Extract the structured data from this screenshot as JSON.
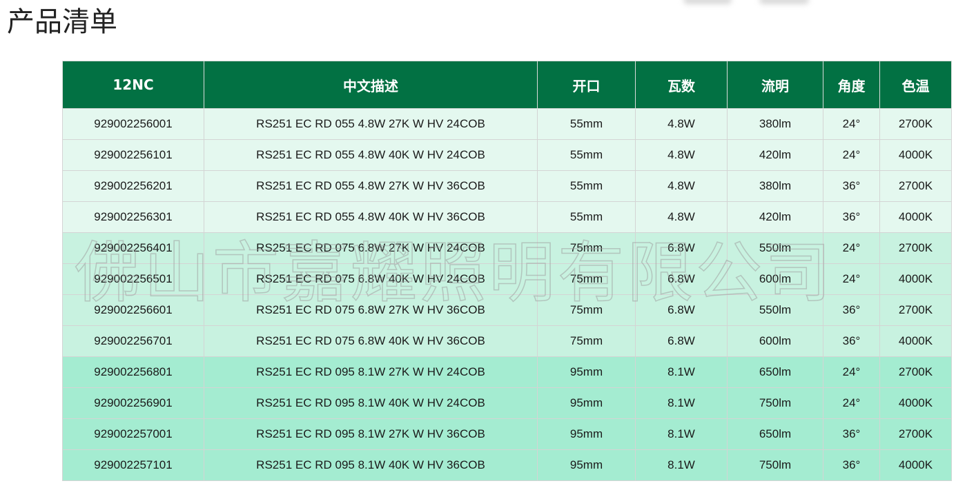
{
  "page": {
    "title": "产品清单"
  },
  "watermark": "佛山市嘉耀照明有限公司",
  "table": {
    "headers": [
      "12NC",
      "中文描述",
      "开口",
      "瓦数",
      "流明",
      "角度",
      "色温"
    ],
    "rows": [
      [
        "929002256001",
        "RS251 EC RD 055 4.8W 27K W HV 24COB",
        "55mm",
        "4.8W",
        "380lm",
        "24°",
        "2700K"
      ],
      [
        "929002256101",
        "RS251 EC RD 055 4.8W 40K W HV 24COB",
        "55mm",
        "4.8W",
        "420lm",
        "24°",
        "4000K"
      ],
      [
        "929002256201",
        "RS251 EC RD 055 4.8W 27K W HV 36COB",
        "55mm",
        "4.8W",
        "380lm",
        "36°",
        "2700K"
      ],
      [
        "929002256301",
        "RS251 EC RD 055 4.8W 40K W HV 36COB",
        "55mm",
        "4.8W",
        "420lm",
        "36°",
        "4000K"
      ],
      [
        "929002256401",
        "RS251 EC RD 075 6.8W 27K W HV 24COB",
        "75mm",
        "6.8W",
        "550lm",
        "24°",
        "2700K"
      ],
      [
        "929002256501",
        "RS251 EC RD 075 6.8W 40K W HV 24COB",
        "75mm",
        "6.8W",
        "600lm",
        "24°",
        "4000K"
      ],
      [
        "929002256601",
        "RS251 EC RD 075 6.8W 27K W HV 36COB",
        "75mm",
        "6.8W",
        "550lm",
        "36°",
        "2700K"
      ],
      [
        "929002256701",
        "RS251 EC RD 075 6.8W 40K W HV 36COB",
        "75mm",
        "6.8W",
        "600lm",
        "36°",
        "4000K"
      ],
      [
        "929002256801",
        "RS251 EC RD 095 8.1W 27K W HV 24COB",
        "95mm",
        "8.1W",
        "650lm",
        "24°",
        "2700K"
      ],
      [
        "929002256901",
        "RS251 EC RD 095 8.1W 40K W HV 24COB",
        "95mm",
        "8.1W",
        "750lm",
        "24°",
        "4000K"
      ],
      [
        "929002257001",
        "RS251 EC RD 095 8.1W 27K W HV 36COB",
        "95mm",
        "8.1W",
        "650lm",
        "36°",
        "2700K"
      ],
      [
        "929002257101",
        "RS251 EC RD 095 8.1W 40K W HV 36COB",
        "95mm",
        "8.1W",
        "750lm",
        "36°",
        "4000K"
      ]
    ]
  },
  "colors": {
    "header_bg": "#027143",
    "row_light": "#e4f8ef",
    "row_mid": "#c8f2e0",
    "row_dark": "#a4ecd1"
  }
}
